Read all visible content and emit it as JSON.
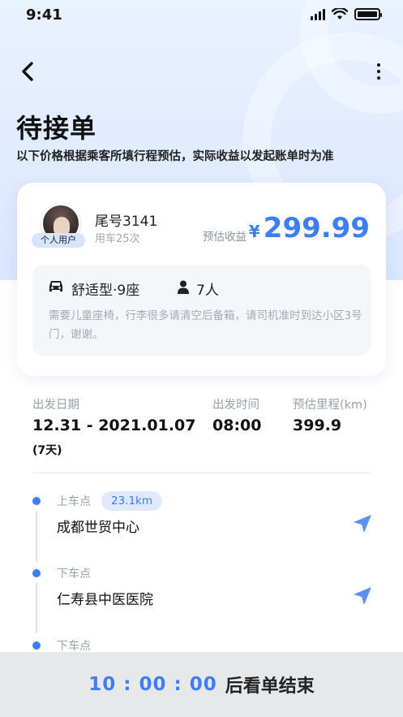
{
  "status_bar": {
    "time": "9:41"
  },
  "header": {
    "title": "待接单",
    "subtitle": "以下价格根据乘客所填行程预估，实际收益以发起账单时为准"
  },
  "passenger": {
    "badge": "个人用户",
    "tail_number": "尾号3141",
    "rides": "用车25次",
    "estimate_label": "预估收益",
    "currency": "¥",
    "amount": "299.99",
    "car_type": "舒适型·9座",
    "passenger_count": "7人",
    "note": "需要儿童座椅，行李很多请清空后备箱，请司机准时到达小区3号门，谢谢。"
  },
  "trip": {
    "date_label": "出发日期",
    "date_value": "12.31 - 2021.01.07",
    "duration": "(7天)",
    "time_label": "出发时间",
    "time_value": "08:00",
    "distance_label": "预估里程(km)",
    "distance_value": "399.9"
  },
  "route": [
    {
      "label": "上车点",
      "name": "成都世贸中心",
      "distance": "23.1km"
    },
    {
      "label": "下车点",
      "name": "仁寿县中医医院"
    },
    {
      "label": "下车点"
    }
  ],
  "footer": {
    "countdown": "10 : 00 : 00",
    "suffix": "后看单结束"
  },
  "colors": {
    "accent": "#3e7ef5",
    "hero_bg": "#dbe7ff",
    "footer_bg": "#e6e8ea"
  },
  "icons": [
    "back-arrow-icon",
    "more-vertical-icon",
    "car-icon",
    "person-icon",
    "navigation-arrow-icon",
    "signal-icon",
    "wifi-icon",
    "battery-icon"
  ]
}
